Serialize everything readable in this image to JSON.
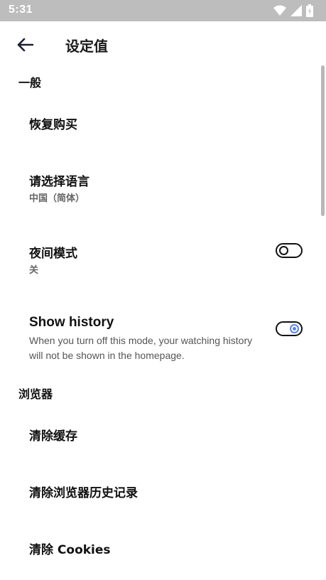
{
  "status_bar": {
    "time": "5:31",
    "icons": [
      "wifi-icon",
      "signal-icon",
      "battery-icon"
    ]
  },
  "app_bar": {
    "back_icon": "arrow-left-icon",
    "title": "设定值"
  },
  "sections": {
    "general": {
      "header": "一般",
      "restore_purchase": {
        "label": "恢复购买"
      },
      "language": {
        "label": "请选择语言",
        "value": "中国（简体）"
      },
      "night_mode": {
        "label": "夜间模式",
        "value": "关",
        "enabled": false
      },
      "show_history": {
        "label": "Show history",
        "description": "When you turn off this mode, your watching history will not be shown in the homepage.",
        "enabled": true
      }
    },
    "browser": {
      "header": "浏览器",
      "clear_cache": {
        "label": "清除缓存"
      },
      "clear_history": {
        "label": "清除浏览器历史记录"
      },
      "clear_cookies": {
        "label": "清除 Cookies"
      }
    }
  },
  "colors": {
    "status_bar": "#bdbdbd",
    "accent": "#5b86e5",
    "text": "#111111",
    "secondary_text": "#666666"
  }
}
